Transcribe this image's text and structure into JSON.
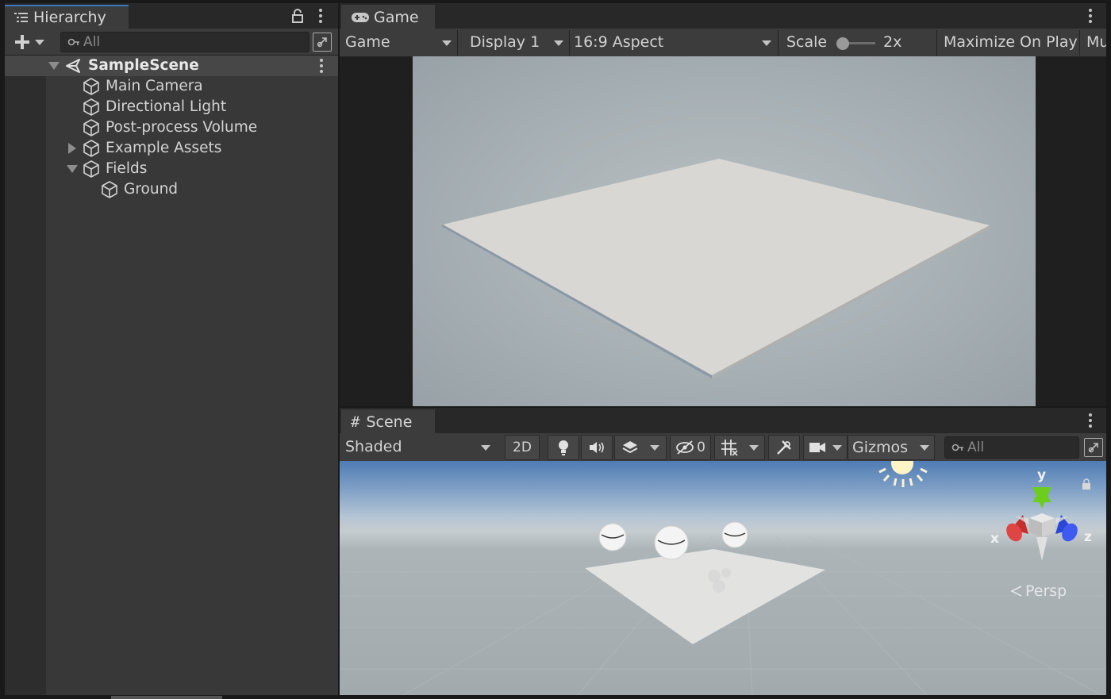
{
  "hierarchy": {
    "tab_title": "Hierarchy",
    "search_placeholder": "All",
    "scene_name": "SampleScene",
    "items": [
      {
        "label": "Main Camera"
      },
      {
        "label": "Directional Light"
      },
      {
        "label": "Post-process Volume"
      },
      {
        "label": "Example Assets"
      },
      {
        "label": "Fields"
      },
      {
        "label": "Ground"
      }
    ]
  },
  "game": {
    "tab_title": "Game",
    "view_dropdown": "Game",
    "display_dropdown": "Display 1",
    "aspect_dropdown": "16:9 Aspect",
    "scale_label": "Scale",
    "scale_value": "2x",
    "maximize_label": "Maximize On Play",
    "mute_label": "Mu"
  },
  "scene": {
    "tab_title": "Scene",
    "shading_dropdown": "Shaded",
    "mode_2d": "2D",
    "hidden_count": "0",
    "gizmos_label": "Gizmos",
    "search_placeholder": "All",
    "axis_x": "x",
    "axis_y": "y",
    "axis_z": "z",
    "projection_label": "Persp"
  },
  "colors": {
    "accent": "#3a79bb",
    "axis_x": "#c62f2f",
    "axis_y": "#6ccd1f",
    "axis_z": "#2b47d6"
  }
}
